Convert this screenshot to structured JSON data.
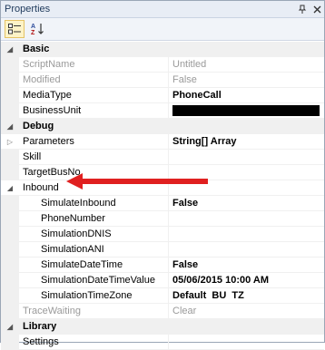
{
  "window": {
    "title": "Properties",
    "pin_icon": "pin-icon",
    "close_icon": "close-icon"
  },
  "toolbar": {
    "categorized_icon": "categorized-icon",
    "alphabetical_icon": "alphabetical-icon",
    "az_text": "AZ"
  },
  "categories": [
    {
      "label": "Basic",
      "expanded": true
    },
    {
      "label": "Debug",
      "expanded": true
    },
    {
      "label": "Library",
      "expanded": true
    }
  ],
  "basic": [
    {
      "name": "ScriptName",
      "value": "Untitled",
      "readonly": true
    },
    {
      "name": "Modified",
      "value": "False",
      "readonly": true
    },
    {
      "name": "MediaType",
      "value": "PhoneCall",
      "bold": true
    },
    {
      "name": "BusinessUnit",
      "value": "",
      "redacted": true
    }
  ],
  "debug": [
    {
      "name": "Parameters",
      "value": "String[] Array",
      "bold": true,
      "expandable": true
    },
    {
      "name": "Skill",
      "value": ""
    },
    {
      "name": "TargetBusNo",
      "value": ""
    },
    {
      "name": "Inbound",
      "value": "",
      "expanded": true
    }
  ],
  "inbound": [
    {
      "name": "SimulateInbound",
      "value": "False",
      "bold": true
    },
    {
      "name": "PhoneNumber",
      "value": ""
    },
    {
      "name": "SimulationDNIS",
      "value": ""
    },
    {
      "name": "SimulationANI",
      "value": ""
    },
    {
      "name": "SimulateDateTime",
      "value": "False",
      "bold": true
    },
    {
      "name": "SimulationDateTimeValue",
      "value": "05/06/2015 10:00 AM",
      "bold": true
    },
    {
      "name": "SimulationTimeZone",
      "value": "Default  BU  TZ",
      "bold": true
    }
  ],
  "debug_after": [
    {
      "name": "TraceWaiting",
      "value": "Clear",
      "readonly": true
    }
  ],
  "library": [
    {
      "name": "Settings",
      "value": ""
    }
  ],
  "colors": {
    "arrow": "#e02020",
    "category_bg": "#f0f0f0"
  }
}
